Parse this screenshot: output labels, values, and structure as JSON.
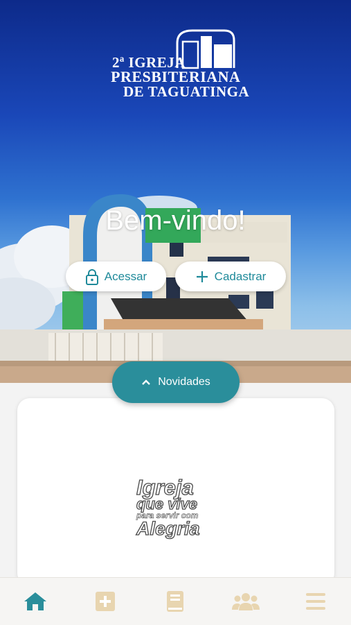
{
  "logo": {
    "line1": "2ª IGREJA",
    "line2": "PRESBITERIANA",
    "line3": "DE TAGUATINGA"
  },
  "hero": {
    "welcome": "Bem-vindo!",
    "login_label": "Acessar",
    "register_label": "Cadastrar"
  },
  "news": {
    "toggle_label": "Novidades",
    "slogan": [
      "Igreja",
      "que vive",
      "para servir com",
      "Alegria"
    ]
  },
  "tabbar": {
    "items": [
      "home-icon",
      "plus-square-icon",
      "book-icon",
      "users-icon",
      "menu-icon"
    ],
    "active_color": "#2a8e9b",
    "inactive_color": "#e8d5b0"
  },
  "colors": {
    "accent": "#2a8e9b",
    "sky_top": "#0d2a8a"
  }
}
